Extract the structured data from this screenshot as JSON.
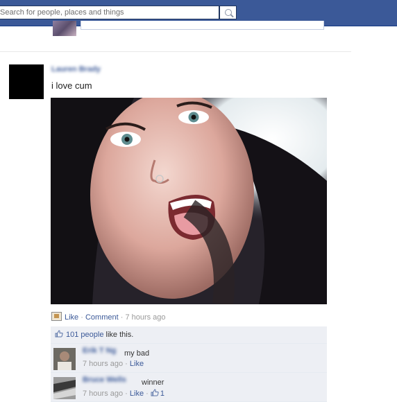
{
  "search": {
    "placeholder": "Search for people, places and things"
  },
  "post": {
    "author_name": "Lauren Brady",
    "status": "i love cum",
    "actions": {
      "like": "Like",
      "comment": "Comment",
      "time": "7 hours ago",
      "sep": " · "
    },
    "likes": {
      "count_text": "101 people",
      "suffix": " like this."
    }
  },
  "comments": [
    {
      "name": "Erik T Ng",
      "text": "my bad",
      "time": "7 hours ago",
      "like": "Like",
      "likes": ""
    },
    {
      "name": "Bruce Wells",
      "text": "winner",
      "time": "7 hours ago",
      "like": "Like",
      "likes": "1"
    }
  ],
  "colors": {
    "brand": "#3b5998",
    "link": "#3b5998",
    "ufi_bg": "#edeff4"
  },
  "icons": [
    "search-icon",
    "photo-icon",
    "like-thumb-icon"
  ]
}
